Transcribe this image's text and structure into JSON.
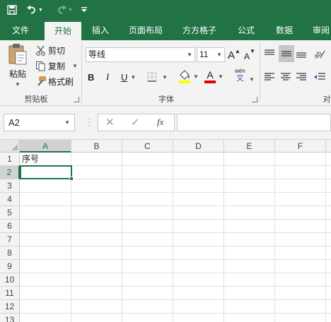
{
  "quick_access": {
    "save_icon": "save-icon",
    "undo_icon": "undo-icon",
    "redo_icon": "redo-icon",
    "customize_icon": "customize-qat-icon"
  },
  "tabs": {
    "file": "文件",
    "home": "开始",
    "insert": "插入",
    "page_layout": "页面布局",
    "fangfang": "方方格子",
    "formulas": "公式",
    "data": "数据",
    "review": "审阅"
  },
  "clipboard": {
    "paste": "粘贴",
    "cut": "剪切",
    "copy": "复制",
    "format_painter": "格式刷",
    "label": "剪贴板"
  },
  "font": {
    "name": "等线",
    "size": "11",
    "bold": "B",
    "italic": "I",
    "underline": "U",
    "font_color_glyph": "A",
    "phonetic_top": "wén",
    "phonetic_bottom": "文",
    "label": "字体",
    "grow_glyph": "A",
    "shrink_glyph": "A",
    "highlight_color": "#ffff00",
    "font_color": "#e00000"
  },
  "alignment": {
    "label": "对"
  },
  "formula_bar": {
    "name_box": "A2",
    "cancel_glyph": "✕",
    "enter_glyph": "✓",
    "fx_glyph": "fx",
    "formula": ""
  },
  "grid": {
    "columns": [
      "A",
      "B",
      "C",
      "D",
      "E",
      "F"
    ],
    "rows": [
      "1",
      "2",
      "3",
      "4",
      "5",
      "6",
      "7",
      "8",
      "9",
      "10",
      "11",
      "12",
      "13"
    ],
    "cells": {
      "A1": "序号"
    },
    "selected_cell": "A2"
  },
  "theme": {
    "accent": "#217346",
    "ribbon_bg": "#f3f3f3"
  }
}
